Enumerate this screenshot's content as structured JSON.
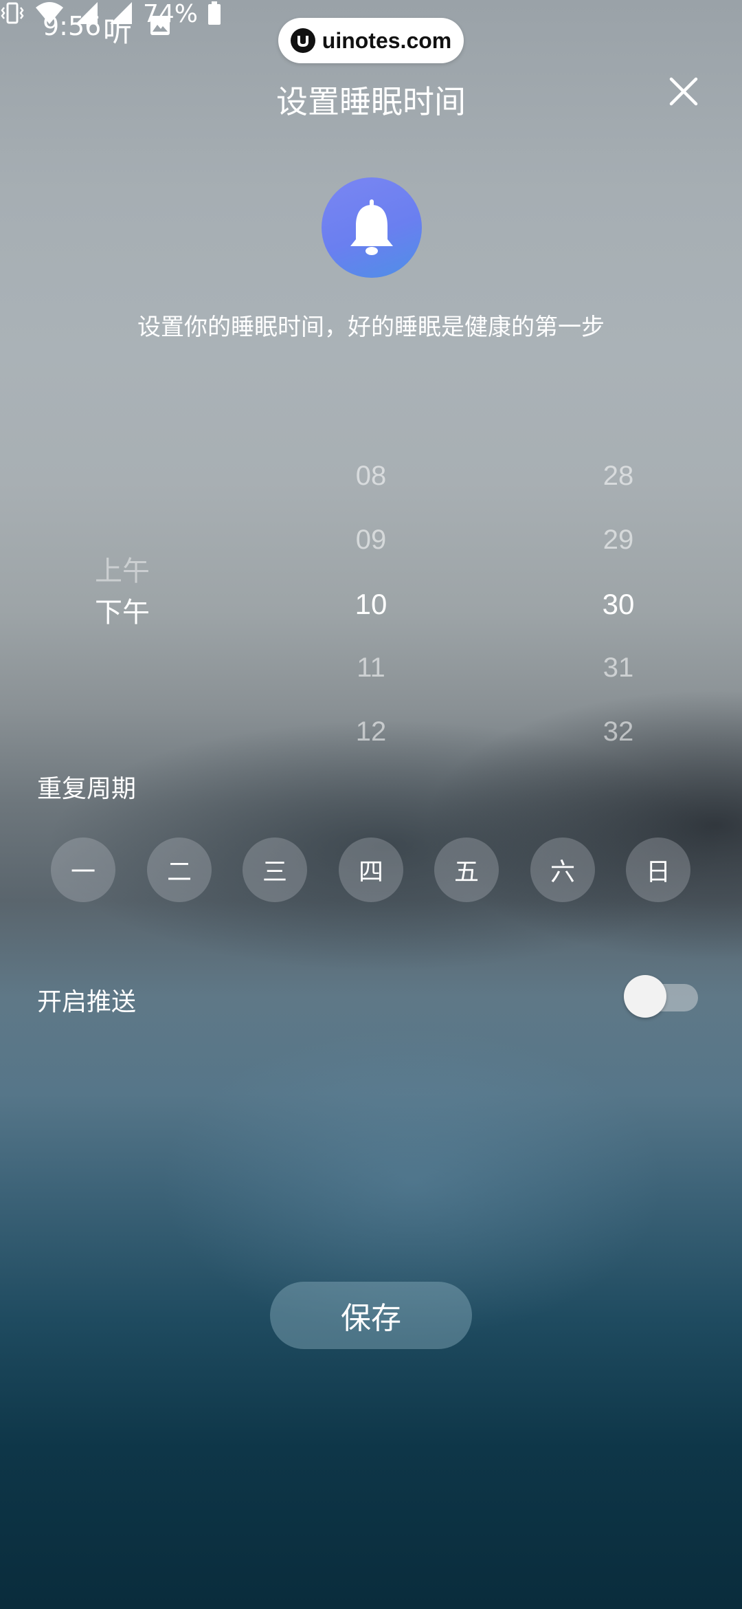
{
  "status_bar": {
    "time": "9:56",
    "ting": "听",
    "battery": "74%",
    "icons": [
      "image-icon",
      "vibrate-icon",
      "wifi-icon",
      "signal-icon",
      "signal-icon",
      "battery-icon"
    ]
  },
  "watermark": {
    "text": "uinotes.com"
  },
  "header": {
    "title": "设置睡眠时间",
    "close_icon": "close-icon"
  },
  "hero": {
    "icon": "bell-icon",
    "subtitle": "设置你的睡眠时间，好的睡眠是健康的第一步"
  },
  "picker": {
    "ampm": [
      "上午",
      "下午"
    ],
    "ampm_selected": "下午",
    "hours": [
      "08",
      "09",
      "10",
      "11",
      "12"
    ],
    "hour_selected": "10",
    "minutes": [
      "28",
      "29",
      "30",
      "31",
      "32"
    ],
    "minute_selected": "30"
  },
  "repeat": {
    "label": "重复周期",
    "days": [
      "一",
      "二",
      "三",
      "四",
      "五",
      "六",
      "日"
    ]
  },
  "push": {
    "label": "开启推送",
    "enabled": false
  },
  "save": {
    "label": "保存"
  },
  "colors": {
    "bell_start": "#7a86f2",
    "bell_end": "#4f8fe6",
    "text": "#ffffff"
  }
}
